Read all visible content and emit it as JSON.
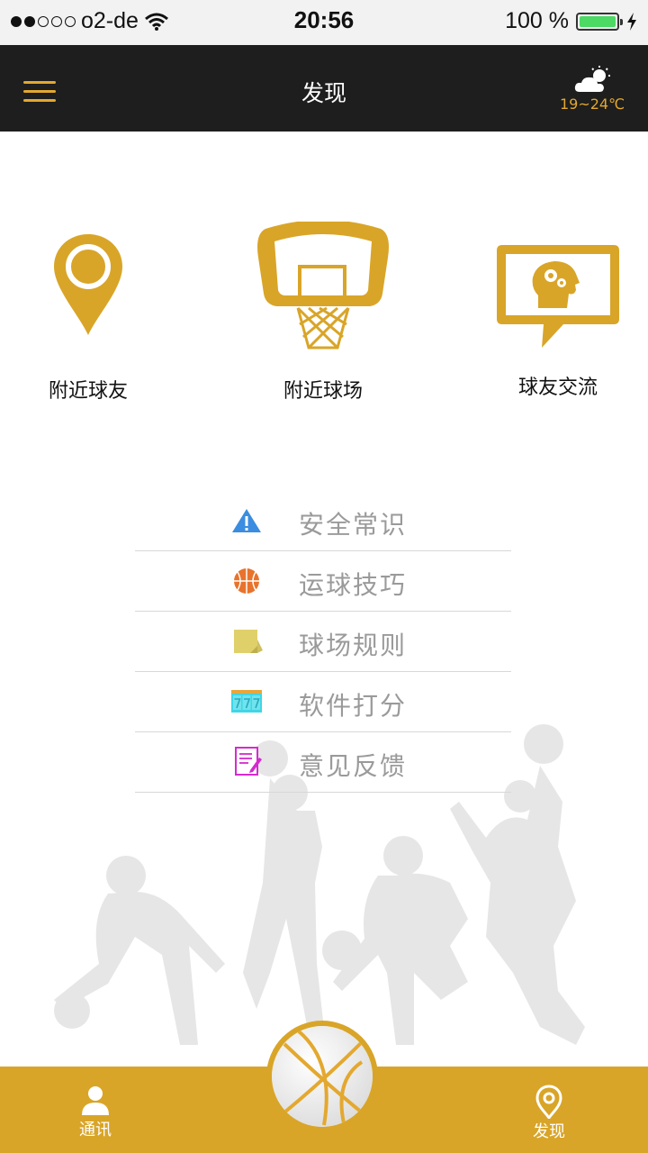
{
  "status_bar": {
    "carrier": "o2-de",
    "time": "20:56",
    "battery_text": "100 %",
    "battery_level": 1.0
  },
  "nav": {
    "title": "发现",
    "weather_temp": "19~24℃"
  },
  "features": [
    {
      "label": "附近球友",
      "icon": "map-pin-icon"
    },
    {
      "label": "附近球场",
      "icon": "basketball-hoop-icon"
    },
    {
      "label": "球友交流",
      "icon": "head-gears-chat-icon"
    }
  ],
  "menu": [
    {
      "label": "安全常识",
      "icon": "warning-icon"
    },
    {
      "label": "运球技巧",
      "icon": "basketball-icon"
    },
    {
      "label": "球场规则",
      "icon": "note-icon"
    },
    {
      "label": "软件打分",
      "icon": "slot-777-icon"
    },
    {
      "label": "意见反馈",
      "icon": "feedback-form-icon"
    }
  ],
  "tabbar": {
    "left_label": "通讯",
    "right_label": "发现"
  },
  "colors": {
    "accent": "#e3a82f",
    "feature_gold": "#d9a528",
    "nav_bg": "#1e1e1e",
    "menu_text": "#9a9a9a"
  }
}
